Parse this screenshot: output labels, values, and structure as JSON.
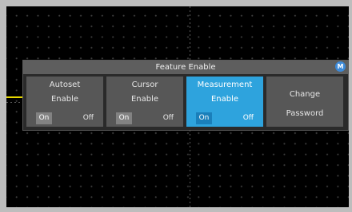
{
  "dialog": {
    "title": "Feature Enable",
    "badge": "M",
    "options": [
      {
        "line1": "Autoset",
        "line2": "Enable",
        "on": "On",
        "off": "Off",
        "selected": false
      },
      {
        "line1": "Cursor",
        "line2": "Enable",
        "on": "On",
        "off": "Off",
        "selected": false
      },
      {
        "line1": "Measurement",
        "line2": "Enable",
        "on": "On",
        "off": "Off",
        "selected": true
      },
      {
        "line1": "Change",
        "line2": "Password",
        "selected": false
      }
    ]
  },
  "colors": {
    "accent": "#2ea3dd",
    "trace": "#e7d800",
    "badge": "#3d8ad8"
  }
}
